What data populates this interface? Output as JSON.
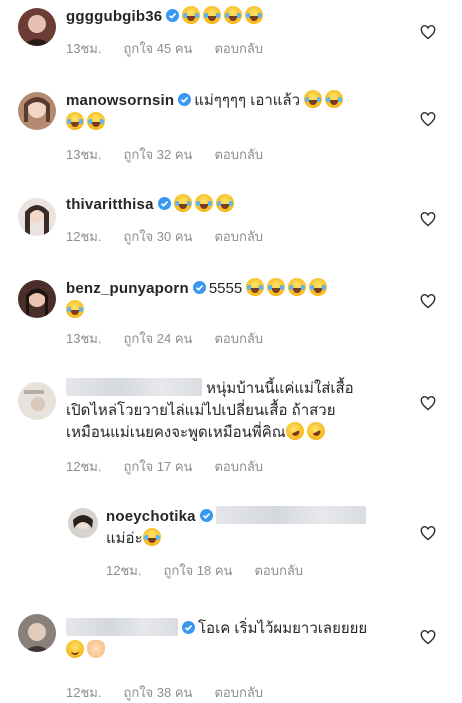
{
  "comments": [
    {
      "username": "ggggubgib36",
      "verified": true,
      "text": "",
      "emoji": [
        "cry",
        "cry",
        "cry",
        "cry"
      ],
      "time": "13ชม.",
      "likes": "ถูกใจ 45 คน",
      "reply": "ตอบกลับ",
      "avatar_color": "#6b3d34"
    },
    {
      "username": "manowsornsin",
      "verified": true,
      "text": "แม่ๆๆๆๆ เอาแล้ว",
      "emoji": [
        "cry",
        "cry",
        "cry",
        "cry"
      ],
      "time": "13ชม.",
      "likes": "ถูกใจ 32 คน",
      "reply": "ตอบกลับ",
      "avatar_color": "#b58a72"
    },
    {
      "username": "thivaritthisa",
      "verified": true,
      "text": "",
      "emoji": [
        "cry",
        "cry",
        "cry"
      ],
      "time": "12ชม.",
      "likes": "ถูกใจ 30 คน",
      "reply": "ตอบกลับ",
      "avatar_color": "#3a2a27"
    },
    {
      "username": "benz_punyaporn",
      "verified": true,
      "text": "5555",
      "emoji": [
        "cry",
        "cry",
        "cry",
        "cry",
        "cry"
      ],
      "time": "13ชม.",
      "likes": "ถูกใจ 24 คน",
      "reply": "ตอบกลับ",
      "avatar_color": "#4a2e2a"
    },
    {
      "username": "",
      "verified": false,
      "lines": [
        "หนุ่มบ้านนี้แค่แม่ใส่เสื้อ",
        "เปิดไหล่โวยวายไล่แม่ไปเปลี่ยนเสื้อ ถ้าสวย",
        "เหมือนแม่เนยคงจะพูดเหมือนพี่คิณ"
      ],
      "emoji": [
        "rofl",
        "rofl"
      ],
      "time": "12ชม.",
      "likes": "ถูกใจ 17 คน",
      "reply": "ตอบกลับ",
      "avatar_color": "#e7e3dc"
    },
    {
      "username": "noeychotika",
      "verified": true,
      "text": "แม่อ่ะ",
      "emoji": [
        "cry"
      ],
      "time": "12ชม.",
      "likes": "ถูกใจ 18 คน",
      "reply": "ตอบกลับ",
      "avatar_color": "#d6d2cd"
    },
    {
      "username": "",
      "verified": true,
      "text": "โอเค เริ่มไว้ผมยาวเลยยยย",
      "emoji": [
        "smile",
        "ok"
      ],
      "time": "12ชม.",
      "likes": "ถูกใจ 38 คน",
      "reply": "ตอบกลับ",
      "avatar_color": "#8a7f7a"
    }
  ],
  "colors": {
    "verified": "#3897f0",
    "meta": "#8e8e8e"
  },
  "icons": {
    "heart": "heart-icon",
    "verified": "verified-badge-icon"
  }
}
